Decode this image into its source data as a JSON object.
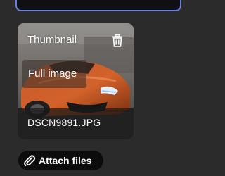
{
  "attachment": {
    "thumbnail_label": "Thumbnail",
    "full_image_label": "Full image",
    "filename": "DSCN9891.JPG",
    "delete_icon": "trash-icon"
  },
  "actions": {
    "attach_label": "Attach files",
    "attach_icon": "paperclip-icon"
  },
  "colors": {
    "background": "#2b2b2b",
    "input_border": "#6a7ee0",
    "button_bg": "#0c0c0c",
    "text": "#ffffff"
  }
}
